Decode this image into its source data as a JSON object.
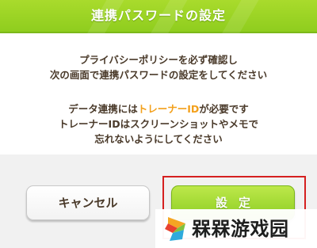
{
  "dialog": {
    "title": "連携パスワードの設定",
    "message_line1": "プライバシーポリシーを必ず確認し",
    "message_line2": "次の画面で連携パスワードの設定をしてください",
    "message_line3_before": "データ連携には",
    "message_line3_highlight": "トレーナーID",
    "message_line3_after": "が必要です",
    "message_line4": "トレーナーIDはスクリーンショットやメモで",
    "message_line5": "忘れないようにしてください",
    "cancel_label": "キャンセル",
    "ok_label": "設定"
  },
  "watermark": {
    "text": "槑槑游戏园",
    "logo_icon": "colorful-s-logo"
  },
  "colors": {
    "title_bar": "#96d122",
    "text": "#4a3a2a",
    "highlight_text": "#f3a01b",
    "ok_button": "#a6dc38",
    "annotation_border": "#d52020"
  }
}
